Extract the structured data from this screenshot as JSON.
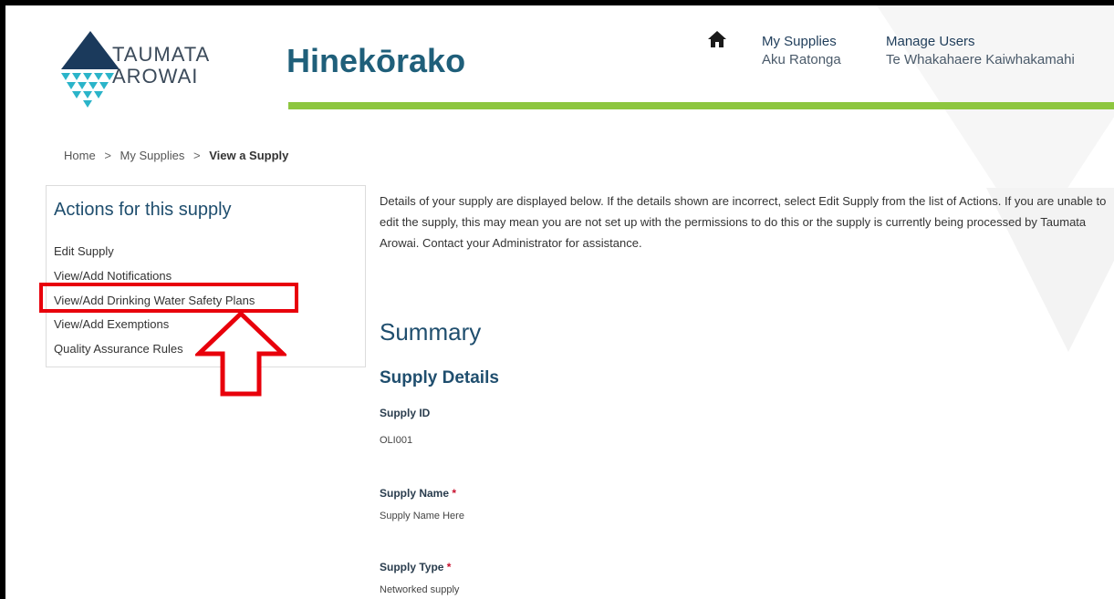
{
  "brand": {
    "logo_line1": "TAUMATA",
    "logo_line2": "AROWAI",
    "app_title": "Hinekōrako",
    "accent_green": "#8dc63f",
    "title_blue": "#1f5f7a"
  },
  "nav": {
    "home_icon": "home-icon",
    "my_supplies": {
      "label": "My Supplies",
      "sub": "Aku Ratonga"
    },
    "manage_users": {
      "label": "Manage Users",
      "sub": "Te Whakahaere Kaiwhakamahi"
    }
  },
  "breadcrumb": {
    "home": "Home",
    "my_supplies": "My Supplies",
    "current": "View a Supply",
    "separator": ">"
  },
  "actions": {
    "title": "Actions for this supply",
    "items": [
      "Edit Supply",
      "View/Add Notifications",
      "View/Add Drinking Water Safety Plans",
      "View/Add Exemptions",
      "Quality Assurance Rules"
    ]
  },
  "main": {
    "intro": "Details of your supply are displayed below.  If the details shown are incorrect, select Edit Supply from the list of Actions.  If you are unable to edit the supply, this may mean you are not set up with the permissions to do this or the supply is currently being processed by Taumata Arowai. Contact your Administrator for assistance.",
    "summary_title": "Summary",
    "section_title": "Supply Details",
    "fields": [
      {
        "label": "Supply ID",
        "required": "",
        "value": "OLI001"
      },
      {
        "label": "Supply Name",
        "required": "*",
        "value": "Supply Name Here"
      },
      {
        "label": "Supply Type",
        "required": "*",
        "value": "Networked supply"
      }
    ]
  },
  "annotation": {
    "highlight_color": "#e8000b"
  }
}
